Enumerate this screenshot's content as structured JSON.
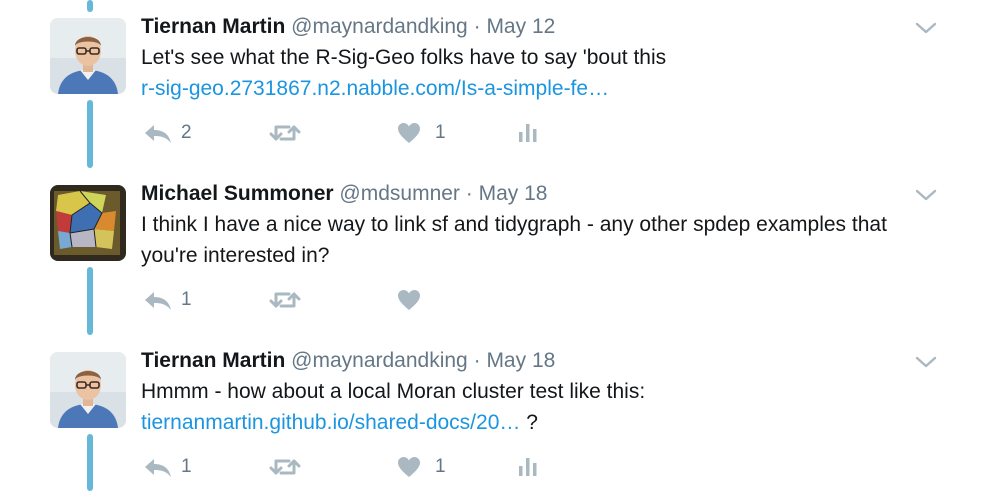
{
  "tweets": [
    {
      "name": "Tiernan Martin",
      "handle": "@maynardandking",
      "separator": "·",
      "date": "May 12",
      "avatar": "man-with-glasses-avatar",
      "text_line1": "Let's see what the R-Sig-Geo folks have to say 'bout this",
      "link": "r-sig-geo.2731867.n2.nabble.com/Is-a-simple-fe…",
      "reply_count": "2",
      "retweet_count": "",
      "like_count": "1",
      "has_analytics": true
    },
    {
      "name": "Michael Summoner",
      "handle": "@mdsumner",
      "separator": "·",
      "date": "May 18",
      "avatar": "colorful-map-avatar",
      "text_line1": "I think I have a nice way to link sf and tidygraph - any other spdep examples that",
      "text_line2": "you're interested in?",
      "reply_count": "1",
      "retweet_count": "",
      "like_count": "",
      "has_analytics": false
    },
    {
      "name": "Tiernan Martin",
      "handle": "@maynardandking",
      "separator": "·",
      "date": "May 18",
      "avatar": "man-with-glasses-avatar",
      "text_line1": "Hmmm - how about a local Moran cluster test like this:",
      "link": "tiernanmartin.github.io/shared-docs/20…",
      "link_suffix": " ?",
      "reply_count": "1",
      "retweet_count": "",
      "like_count": "1",
      "has_analytics": true
    }
  ],
  "icons": {
    "reply": "reply-icon",
    "retweet": "retweet-icon",
    "like": "heart-icon",
    "analytics": "analytics-icon",
    "more": "chevron-down-icon"
  },
  "colors": {
    "thread_line": "#65b8d8",
    "link": "#1b95e0",
    "muted": "#657786",
    "icon": "#aab8c2"
  }
}
